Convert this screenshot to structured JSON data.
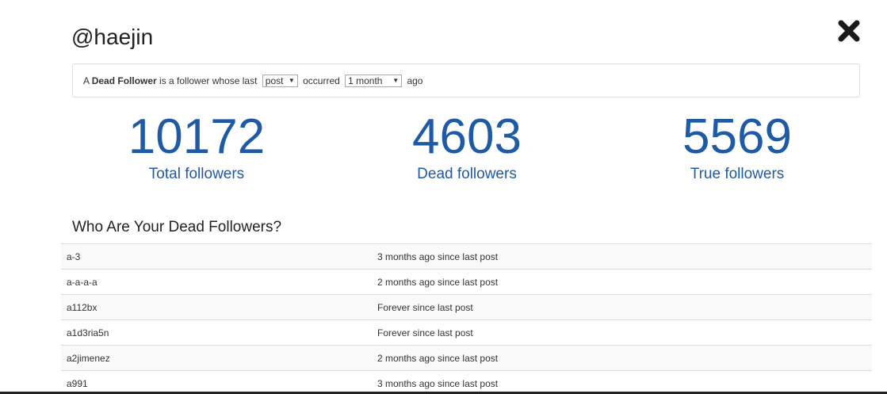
{
  "header": {
    "username": "@haejin"
  },
  "definition": {
    "prefix": "A ",
    "term": "Dead Follower",
    "middle": " is a follower whose last ",
    "activity_select": "post",
    "occurred": " occurred ",
    "period_select": "1 month",
    "suffix": " ago"
  },
  "stats": {
    "total": {
      "value": "10172",
      "label": "Total followers"
    },
    "dead": {
      "value": "4603",
      "label": "Dead followers"
    },
    "true": {
      "value": "5569",
      "label": "True followers"
    }
  },
  "section": {
    "title": "Who Are Your Dead Followers?"
  },
  "followers": [
    {
      "name": "a-3",
      "status": "3 months ago since last post"
    },
    {
      "name": "a-a-a-a",
      "status": "2 months ago since last post"
    },
    {
      "name": "a112bx",
      "status": "Forever since last post"
    },
    {
      "name": "a1d3ria5n",
      "status": "Forever since last post"
    },
    {
      "name": "a2jimenez",
      "status": "2 months ago since last post"
    },
    {
      "name": "a991",
      "status": "3 months ago since last post"
    }
  ],
  "colors": {
    "accent": "#1f5aa6"
  },
  "icons": {
    "close": "close-icon"
  }
}
